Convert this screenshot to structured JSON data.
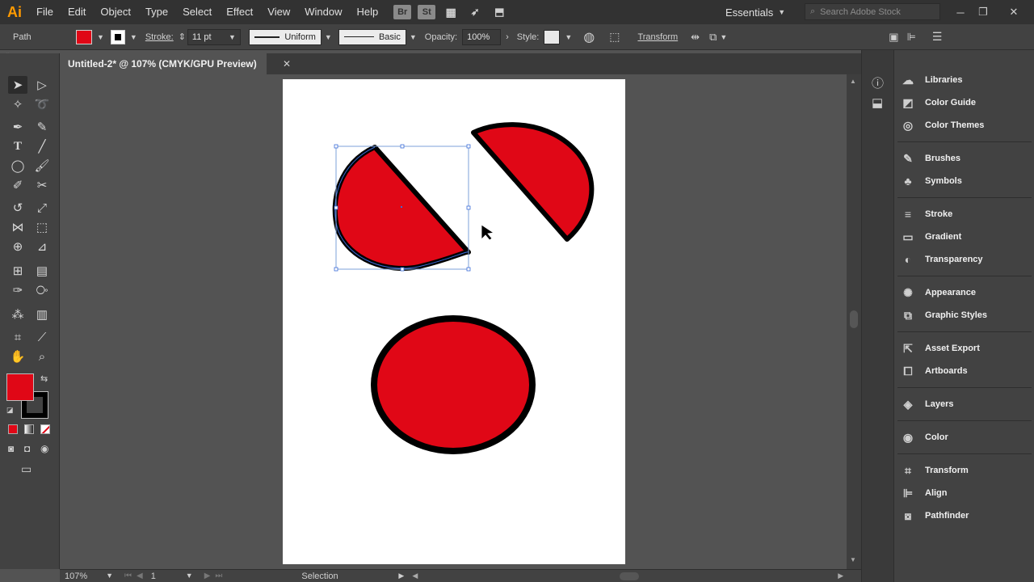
{
  "app": {
    "logo": "Ai"
  },
  "menubar": {
    "items": [
      "File",
      "Edit",
      "Object",
      "Type",
      "Select",
      "Effect",
      "View",
      "Window",
      "Help"
    ],
    "bridge_label": "Br",
    "stock_label": "St",
    "workspace": "Essentials",
    "search_placeholder": "Search Adobe Stock"
  },
  "controlbar": {
    "selection_type": "Path",
    "fill_color": "#e00716",
    "stroke_label": "Stroke:",
    "stroke_weight": "11 pt",
    "profile_label": "Uniform",
    "brush_label": "Basic",
    "opacity_label": "Opacity:",
    "opacity_value": "100%",
    "style_label": "Style:",
    "transform_label": "Transform"
  },
  "document": {
    "tab_title": "Untitled-2* @ 107% (CMYK/GPU Preview)",
    "close_glyph": "✕"
  },
  "toolbar": {
    "fill_color": "#e00716",
    "stroke_color": "#000000",
    "tools": [
      "selection-tool",
      "direct-selection-tool",
      "magic-wand-tool",
      "lasso-tool",
      "pen-tool",
      "curvature-tool",
      "type-tool",
      "line-segment-tool",
      "ellipse-tool",
      "paintbrush-tool",
      "shaper-tool",
      "scissors-tool",
      "rotate-tool",
      "scale-tool",
      "width-tool",
      "free-transform-tool",
      "shape-builder-tool",
      "perspective-grid-tool",
      "mesh-tool",
      "gradient-tool",
      "eyedropper-tool",
      "blend-tool",
      "symbol-sprayer-tool",
      "column-graph-tool",
      "artboard-tool",
      "slice-tool",
      "hand-tool",
      "zoom-tool"
    ]
  },
  "artwork": {
    "fill_color": "#e00716",
    "stroke_color": "#000000"
  },
  "statusbar": {
    "zoom": "107%",
    "artboard_number": "1",
    "current_tool": "Selection"
  },
  "panels": {
    "groups": [
      [
        "Libraries",
        "Color Guide",
        "Color Themes"
      ],
      [
        "Brushes",
        "Symbols"
      ],
      [
        "Stroke",
        "Gradient",
        "Transparency"
      ],
      [
        "Appearance",
        "Graphic Styles"
      ],
      [
        "Asset Export",
        "Artboards"
      ],
      [
        "Layers"
      ],
      [
        "Color"
      ],
      [
        "Transform",
        "Align",
        "Pathfinder"
      ]
    ]
  }
}
